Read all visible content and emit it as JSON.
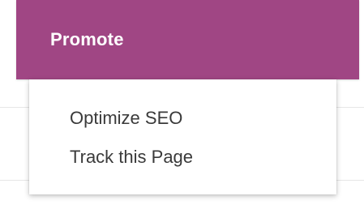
{
  "colors": {
    "promote_bg": "#a04684",
    "menu_text": "#3a3a3a",
    "menu_bg": "#ffffff"
  },
  "promote": {
    "label": "Promote"
  },
  "menu": {
    "items": [
      {
        "label": "Optimize SEO"
      },
      {
        "label": "Track this Page"
      }
    ]
  }
}
